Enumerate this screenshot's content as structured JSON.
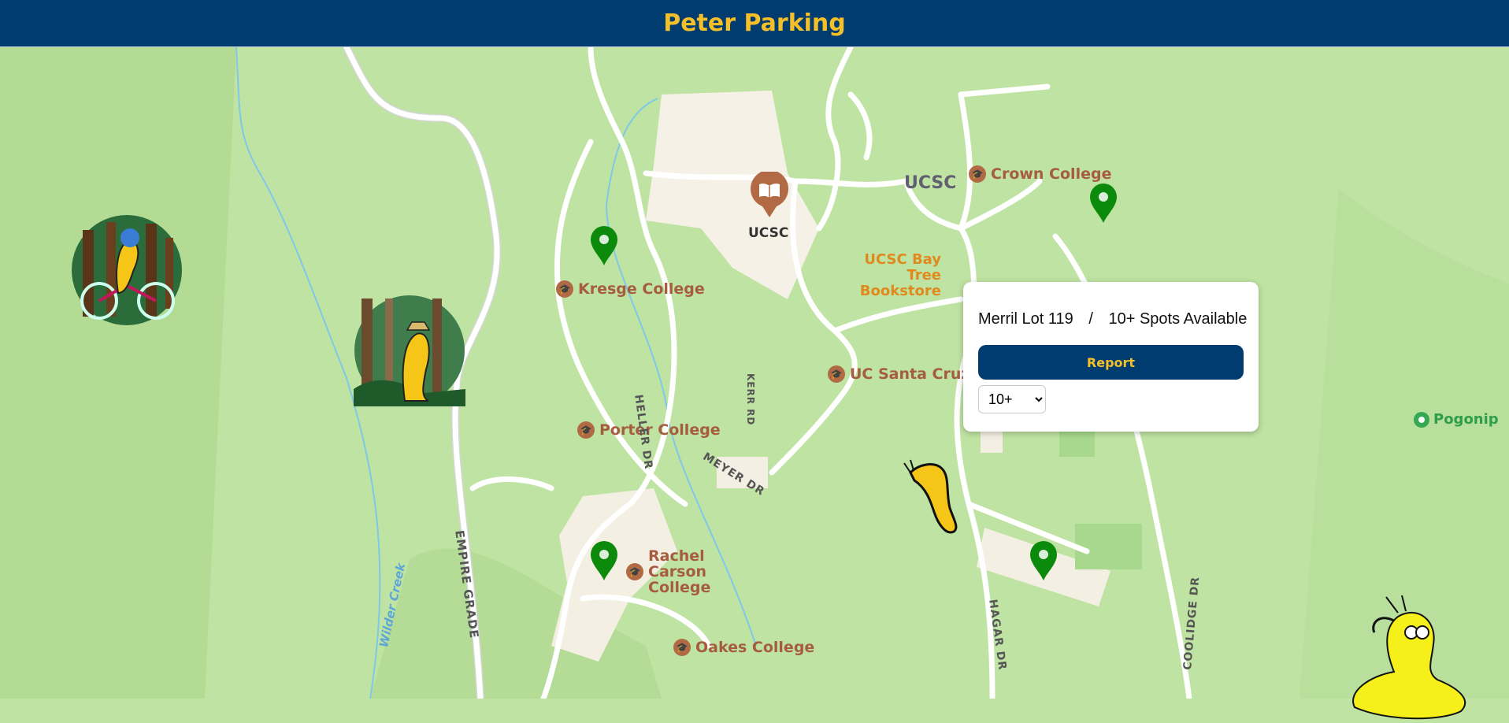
{
  "header": {
    "title": "Peter Parking"
  },
  "map": {
    "pois": [
      {
        "name": "Crown College"
      },
      {
        "name": "Kresge College"
      },
      {
        "name": "UC Santa Cruz"
      },
      {
        "name": "Porter College"
      },
      {
        "name": "Rachel Carson College"
      },
      {
        "name": "Oakes College"
      },
      {
        "name": "UCSC Bay Tree Bookstore"
      },
      {
        "name": "UCSC"
      }
    ],
    "roads": {
      "ucsc_road": "UCSC",
      "heller": "HELLER DR",
      "kerr": "KERR RD",
      "meyer": "MEYER DR",
      "empire": "EMPIRE GRADE",
      "hagar": "HAGAR DR",
      "coolidge": "COOLIDGE DR",
      "creek": "Wilder Creek"
    },
    "park": "Pogonip",
    "colors": {
      "header": "#003c70",
      "accent": "#f5bf2a",
      "pin": "#0b8a0b"
    }
  },
  "popup": {
    "lot_name": "Merril Lot 119",
    "separator": "/",
    "availability": "10+ Spots Available",
    "report_label": "Report",
    "selected_option": "10+"
  }
}
